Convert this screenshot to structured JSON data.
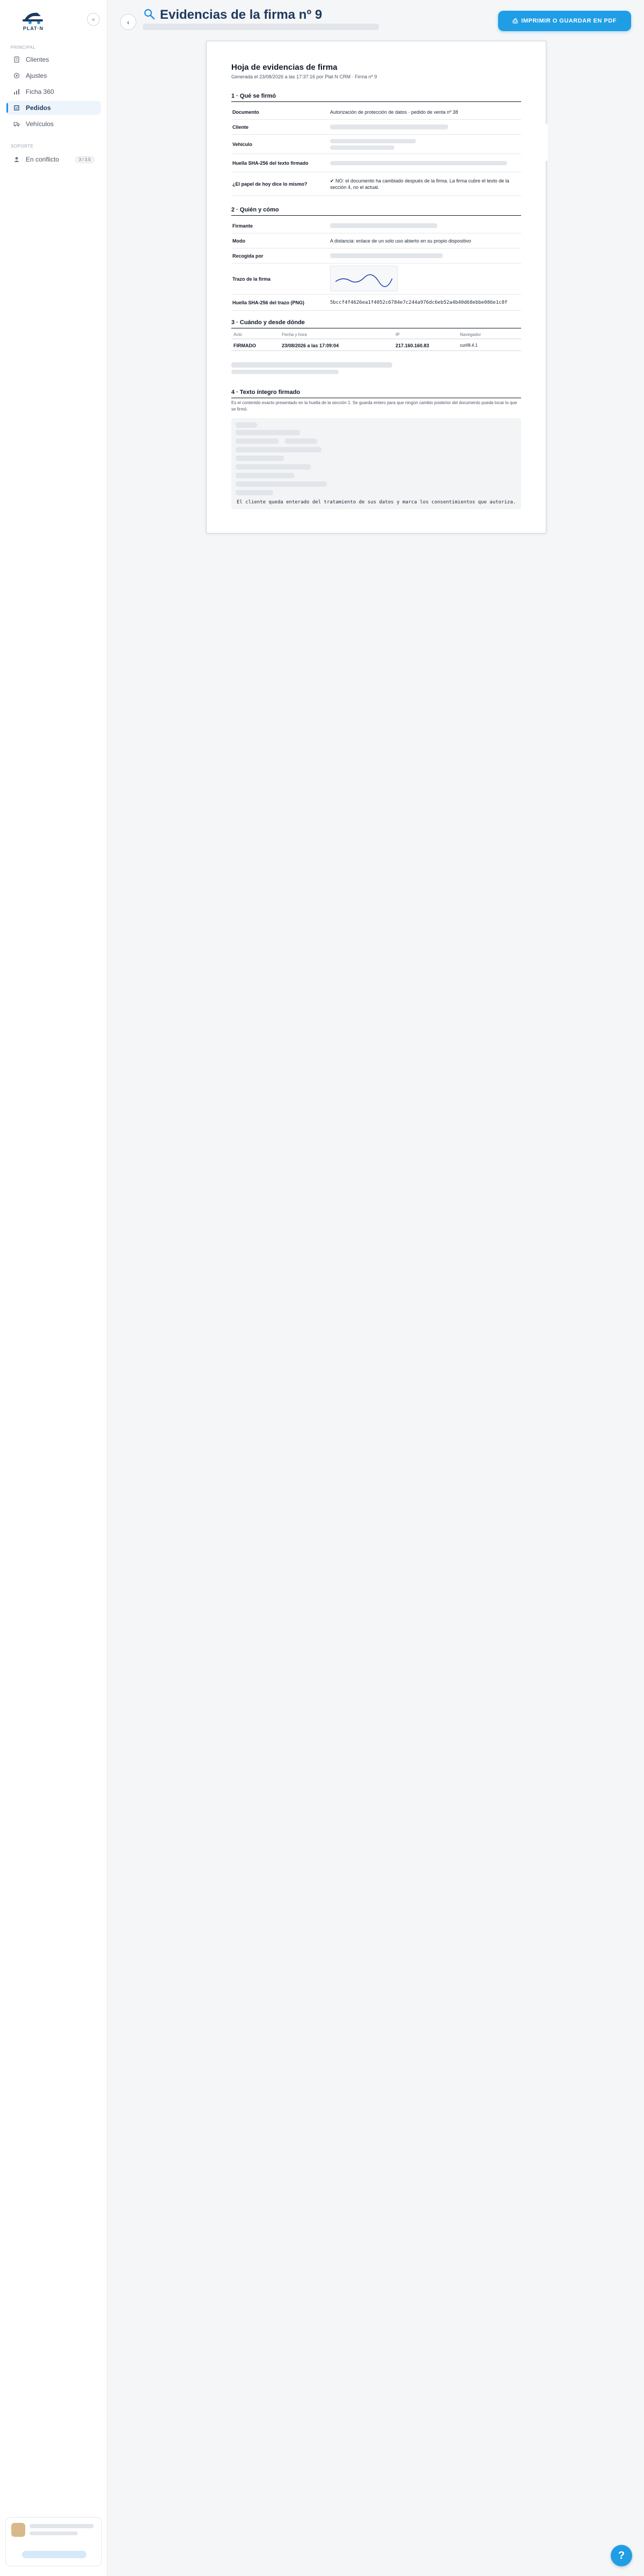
{
  "app": {
    "logo_text": "PLAT·N",
    "title": "Evidencias de la firma nº 9",
    "print_button": "IMPRIMIR O GUARDAR EN PDF"
  },
  "sidebar": {
    "section_main": "Principal",
    "items": [
      {
        "label": "Clientes",
        "icon": "clients-icon"
      },
      {
        "label": "Ajustes",
        "icon": "gear-icon"
      },
      {
        "label": "Ficha 360",
        "icon": "chart-icon"
      },
      {
        "label": "Pedidos",
        "icon": "orders-icon",
        "active": true
      },
      {
        "label": "Vehículos",
        "icon": "truck-icon"
      }
    ],
    "section_support": "Soporte",
    "support_item": {
      "label": "En conflicto",
      "badge": "3 / 3.5"
    }
  },
  "document": {
    "title": "Hoja de evidencias de firma",
    "generated": "Generada el 23/08/2026 a las 17:37:16 por Plat·N CRM · Firma nº 9",
    "sec1": "1 · Qué se firmó",
    "sec1_rows": [
      {
        "key": "Documento",
        "value": "Autorización de protección de datos · pedido de venta nº 38"
      },
      {
        "key": "Cliente",
        "value": ""
      },
      {
        "key": "Vehículo",
        "value": ""
      },
      {
        "key": "Huella SHA-256 del texto firmado",
        "value": ""
      },
      {
        "key": "¿El papel de hoy dice lo mismo?",
        "value": "✔ NO: el documento ha cambiado después de la firma. La firma cubre el texto de la sección 4, no el actual."
      }
    ],
    "sec2": "2 · Quién y cómo",
    "sec2_rows": [
      {
        "key": "Firmante",
        "value": ""
      },
      {
        "key": "Modo",
        "value": "A distancia: enlace de un solo uso abierto en su propio dispositivo"
      },
      {
        "key": "Recogida por",
        "value": ""
      },
      {
        "key": "Trazo de la firma",
        "value": ""
      },
      {
        "key": "Huella SHA-256 del trazo (PNG)",
        "value": "5bccf4f4626ea1f4052c6784e7c244a976dc6eb52a4b40d68ebbe086e1c8f"
      }
    ],
    "sec3": "3 · Cuándo y desde dónde",
    "sec3_headers": [
      "Acto",
      "Fecha y hora",
      "IP",
      "Navegador"
    ],
    "sec3_row": [
      "FIRMADO",
      "23/08/2026 a las 17:09:04",
      "217.160.160.83",
      "curl/8.4.1"
    ],
    "sec4": "4 · Texto íntegro firmado",
    "sec4_note": "Es el contenido exacto presentado en la huella de la sección 1. Se guarda entero para que ningún cambio posterior del documento pueda tocar lo que se firmó.",
    "sec4_last_line": "El cliente queda enterado del tratamiento de sus datos y marca los consentimientos que autoriza."
  },
  "help_button": "?"
}
